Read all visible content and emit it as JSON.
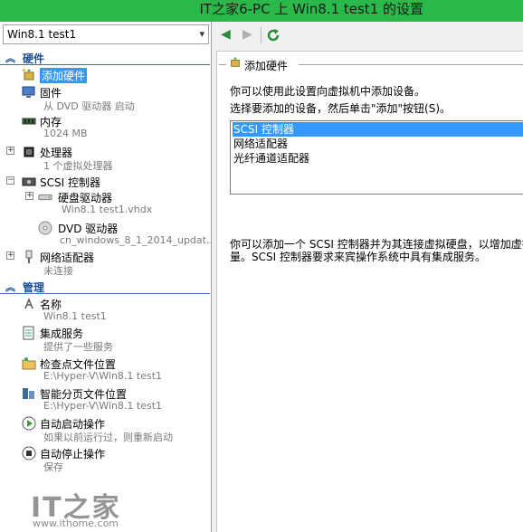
{
  "window": {
    "title": "IT之家6-PC 上 Win8.1 test1 的设置"
  },
  "vm_select": {
    "value": "Win8.1 test1"
  },
  "sections": {
    "hardware": "硬件",
    "management": "管理"
  },
  "hardware_items": [
    {
      "label": "添加硬件",
      "sub": ""
    },
    {
      "label": "固件",
      "sub": "从 DVD 驱动器 启动"
    },
    {
      "label": "内存",
      "sub": "1024 MB"
    },
    {
      "label": "处理器",
      "sub": "1 个虚拟处理器"
    },
    {
      "label": "SCSI 控制器",
      "sub": ""
    },
    {
      "label": "硬盘驱动器",
      "sub": "Win8.1 test1.vhdx"
    },
    {
      "label": "DVD 驱动器",
      "sub": "cn_windows_8_1_2014_updat..."
    },
    {
      "label": "网络适配器",
      "sub": "未连接"
    }
  ],
  "management_items": [
    {
      "label": "名称",
      "sub": "Win8.1 test1"
    },
    {
      "label": "集成服务",
      "sub": "提供了一些服务"
    },
    {
      "label": "检查点文件位置",
      "sub": "E:\\Hyper-V\\Win8.1 test1"
    },
    {
      "label": "智能分页文件位置",
      "sub": "E:\\Hyper-V\\Win8.1 test1"
    },
    {
      "label": "自动启动操作",
      "sub": "如果以前运行过，则重新启动"
    },
    {
      "label": "自动停止操作",
      "sub": "保存"
    }
  ],
  "panel": {
    "title": "添加硬件",
    "intro": "你可以使用此设置向虚拟机中添加设备。",
    "instruction": "选择要添加的设备，然后单击\"添加\"按钮(S)。",
    "devices": [
      "SCSI 控制器",
      "网络适配器",
      "光纤通道适配器"
    ],
    "description_line1": "你可以添加一个 SCSI 控制器并为其连接虚拟硬盘，以增加虚拟",
    "description_line2": "量。SCSI 控制器要求来宾操作系统中具有集成服务。"
  },
  "watermark": {
    "logo": "IT之家",
    "url": "www.ithome.com"
  },
  "colors": {
    "titlebar": "#2bb84a",
    "selection": "#3399ff",
    "section_text": "#1c4e94"
  },
  "icons": {
    "back": "arrow-left-icon",
    "forward": "arrow-right-icon",
    "refresh": "refresh-icon"
  }
}
